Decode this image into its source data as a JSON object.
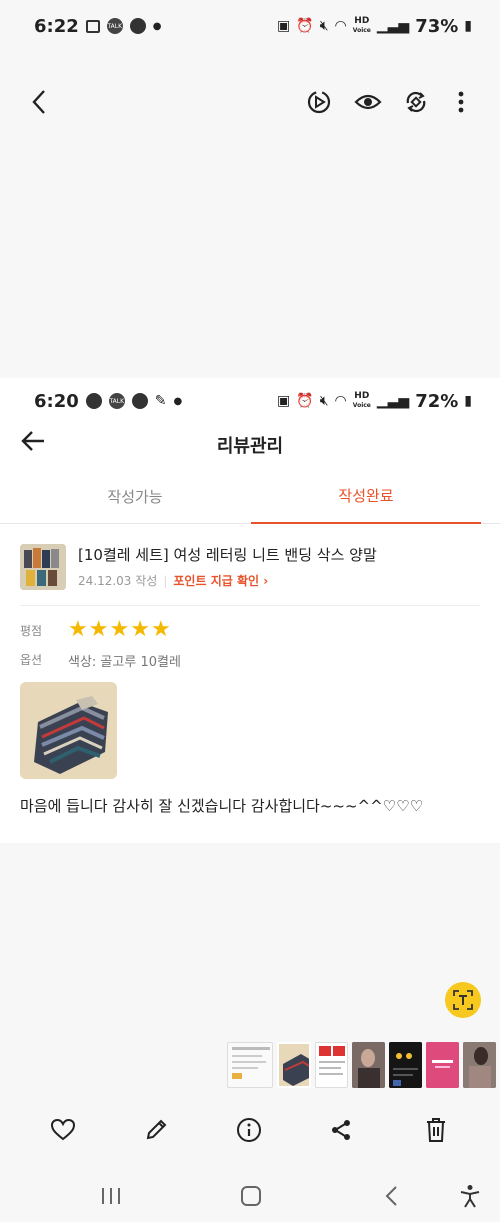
{
  "outer_status": {
    "time": "6:22",
    "battery": "73%",
    "hd_label": "HD",
    "voice_label": "Voice",
    "talk_badge": "TALK"
  },
  "inner_status": {
    "time": "6:20",
    "battery": "72%",
    "hd_label": "HD",
    "voice_label": "Voice",
    "talk_badge": "TALK"
  },
  "inner_header": {
    "title": "리뷰관리"
  },
  "tabs": [
    {
      "label": "작성가능",
      "active": false
    },
    {
      "label": "작성완료",
      "active": true
    }
  ],
  "product": {
    "name": "[10켤레 세트] 여성 레터링 니트 밴딩 삭스 양말",
    "date": "24.12.03 작성",
    "point_link": "포인트 지급 확인 ›"
  },
  "review": {
    "rating_label": "평점",
    "rating": 5,
    "option_label": "옵션",
    "option_value": "색상: 골고루 10켤레",
    "text": "마음에 듭니다 감사히 잘 신겠습니다 감사합니다~~~^^♡♡♡"
  },
  "icons": {
    "back": "back-arrow-icon",
    "video": "video-remaster-icon",
    "eye": "eye-icon",
    "rotate": "rotate-icon",
    "more": "more-vertical-icon",
    "text_extract": "text-extract-icon",
    "like": "heart-icon",
    "edit": "pencil-icon",
    "info": "info-icon",
    "share": "share-icon",
    "delete": "trash-icon"
  },
  "colors": {
    "accent": "#e8532b",
    "star": "#f5b800",
    "fab": "#f7c81e"
  }
}
